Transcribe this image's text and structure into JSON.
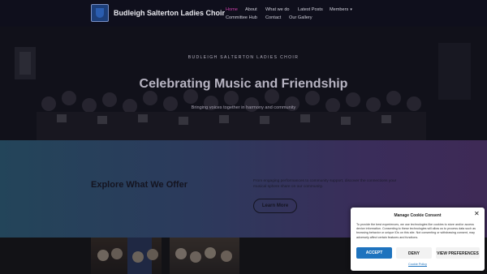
{
  "header": {
    "site_title": "Budleigh Salterton Ladies Choir",
    "logo_icon": "choir-crest-icon",
    "nav": [
      {
        "label": "Home",
        "active": true
      },
      {
        "label": "About"
      },
      {
        "label": "What we do"
      },
      {
        "label": "Latest Posts"
      },
      {
        "label": "Members",
        "has_dropdown": true
      },
      {
        "label": "Committee Hub"
      },
      {
        "label": "Contact"
      },
      {
        "label": "Our Gallery"
      }
    ],
    "active_color": "#c93fa8",
    "dropdown_icon": "chevron-down-icon"
  },
  "hero": {
    "kicker": "BUDLEIGH SALTERTON LADIES CHOIR",
    "title": "Celebrating Music and Friendship",
    "subtitle": "Bringing voices together in harmony and community"
  },
  "explore": {
    "title": "Explore What We Offer",
    "description": "From engaging performances to community support, discover the connections your musical sphere share on our community.",
    "button_label": "Learn More"
  },
  "cookie": {
    "title": "Manage Cookie Consent",
    "close_icon": "close-icon",
    "text": "To provide the best experiences, we use technologies like cookies to store and/or access device information. Consenting to these technologies will allow us to process data such as browsing behavior or unique IDs on this site. Not consenting or withdrawing consent, may adversely affect certain features and functions.",
    "accept_label": "ACCEPT",
    "deny_label": "DENY",
    "prefs_label": "VIEW PREFERENCES",
    "policy_label": "Cookie Policy",
    "accent": "#1e73be"
  }
}
